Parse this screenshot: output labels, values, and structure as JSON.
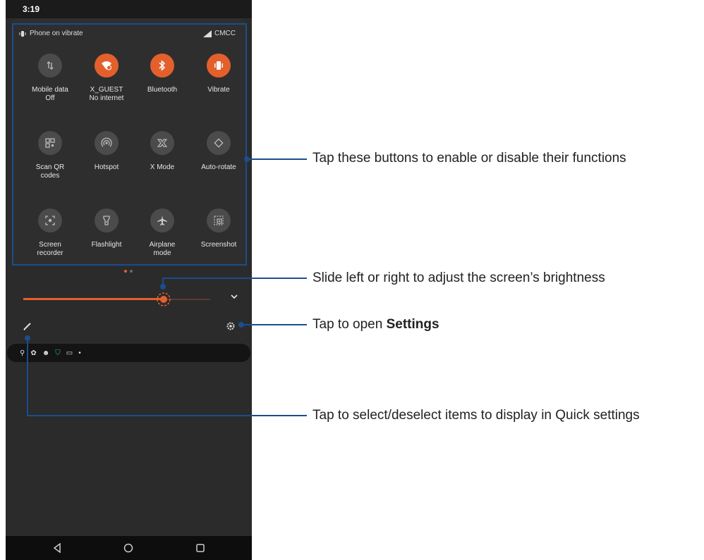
{
  "status": {
    "time": "3:19",
    "vibrate_text": "Phone on vibrate",
    "carrier": "CMCC"
  },
  "tiles": [
    {
      "label": "Mobile data",
      "sub": "Off",
      "icon": "data-arrows-icon",
      "active": false
    },
    {
      "label": "X_GUEST",
      "sub": "No internet",
      "icon": "wifi-off-icon",
      "active": true
    },
    {
      "label": "Bluetooth",
      "sub": "",
      "icon": "bluetooth-icon",
      "active": true
    },
    {
      "label": "Vibrate",
      "sub": "",
      "icon": "vibrate-icon",
      "active": true
    },
    {
      "label": "Scan QR",
      "sub": "codes",
      "icon": "qr-code-icon",
      "active": false
    },
    {
      "label": "Hotspot",
      "sub": "",
      "icon": "hotspot-icon",
      "active": false
    },
    {
      "label": "X Mode",
      "sub": "",
      "icon": "x-mode-icon",
      "active": false
    },
    {
      "label": "Auto-rotate",
      "sub": "",
      "icon": "auto-rotate-icon",
      "active": false
    },
    {
      "label": "Screen",
      "sub": "recorder",
      "icon": "screen-recorder-icon",
      "active": false
    },
    {
      "label": "Flashlight",
      "sub": "",
      "icon": "flashlight-icon",
      "active": false
    },
    {
      "label": "Airplane",
      "sub": "mode",
      "icon": "airplane-icon",
      "active": false
    },
    {
      "label": "Screenshot",
      "sub": "",
      "icon": "screenshot-icon",
      "active": false
    }
  ],
  "brightness": {
    "level": 0.75
  },
  "annotations": {
    "buttons": "Tap these buttons to enable or disable their functions",
    "brightness": "Slide left or right to adjust the screen’s brightness",
    "settings_prefix": "Tap to open ",
    "settings_bold": "Settings",
    "edit": "Tap to select/deselect items to display in Quick settings"
  },
  "colors": {
    "accent": "#e3602d",
    "callout": "#1a4e8c",
    "panel": "#2e2e2e"
  }
}
